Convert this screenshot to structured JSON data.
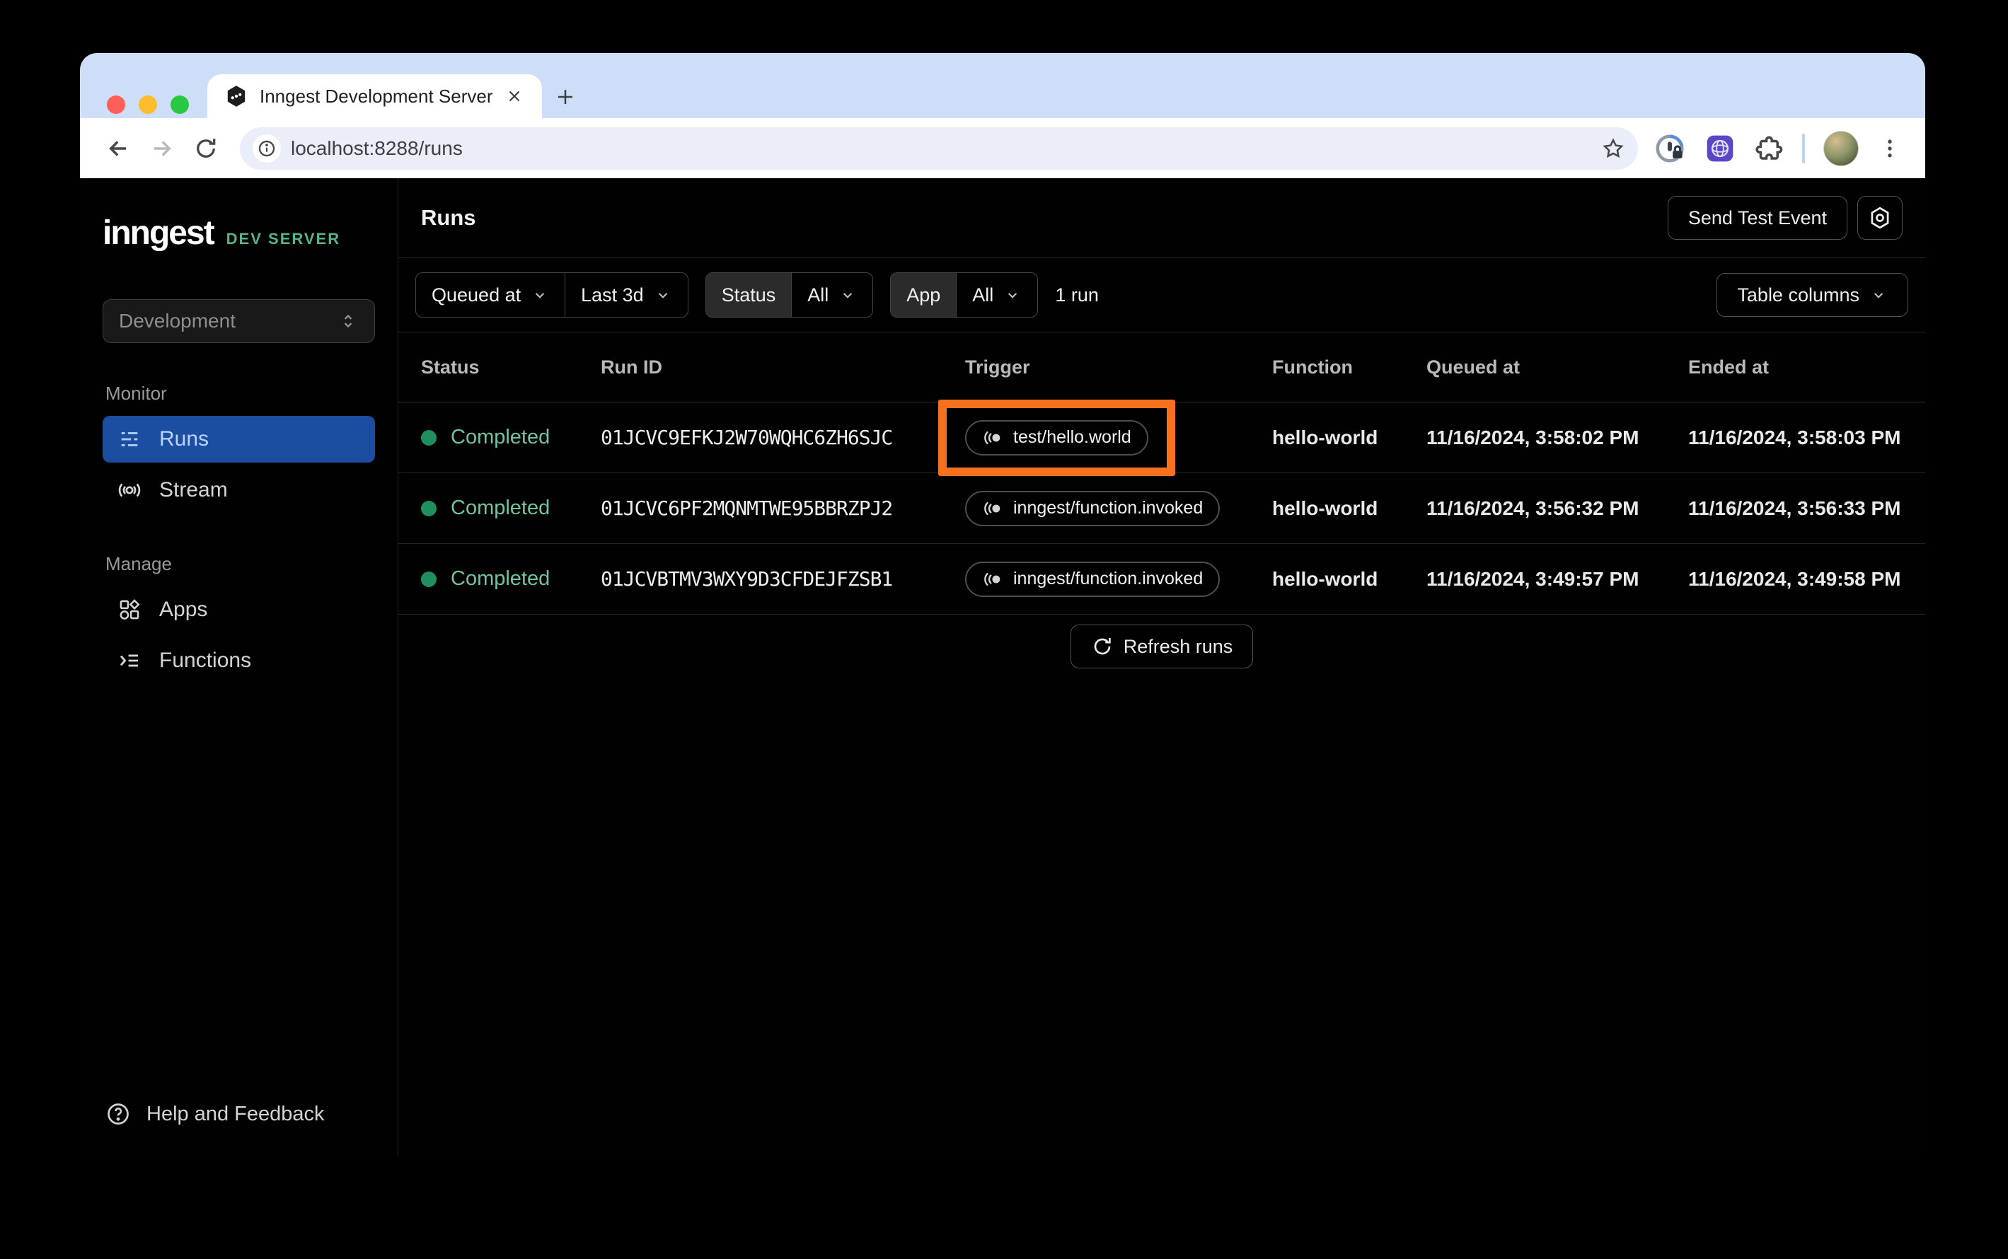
{
  "browser": {
    "tab_title": "Inngest Development Server",
    "url": "localhost:8288/runs"
  },
  "sidebar": {
    "logo": "inngest",
    "logo_badge": "DEV SERVER",
    "env_select": {
      "value": "Development"
    },
    "sections": [
      {
        "label": "Monitor",
        "items": [
          {
            "label": "Runs",
            "active": true
          },
          {
            "label": "Stream",
            "active": false
          }
        ]
      },
      {
        "label": "Manage",
        "items": [
          {
            "label": "Apps",
            "active": false
          },
          {
            "label": "Functions",
            "active": false
          }
        ]
      }
    ],
    "footer": {
      "help_label": "Help and Feedback"
    }
  },
  "header": {
    "title": "Runs",
    "send_test_event_label": "Send Test Event"
  },
  "filters": {
    "queued_at_label": "Queued at",
    "time_range_value": "Last 3d",
    "status_label": "Status",
    "status_value": "All",
    "app_label": "App",
    "app_value": "All",
    "run_count": "1 run",
    "table_columns_label": "Table columns"
  },
  "table": {
    "columns": {
      "status": "Status",
      "run_id": "Run ID",
      "trigger": "Trigger",
      "function": "Function",
      "queued_at": "Queued at",
      "ended_at": "Ended at"
    },
    "rows": [
      {
        "status": "Completed",
        "run_id": "01JCVC9EFKJ2W70WQHC6ZH6SJC",
        "trigger": "test/hello.world",
        "function": "hello-world",
        "queued_at": "11/16/2024, 3:58:02 PM",
        "ended_at": "11/16/2024, 3:58:03 PM",
        "highlighted": true
      },
      {
        "status": "Completed",
        "run_id": "01JCVC6PF2MQNMTWE95BBRZPJ2",
        "trigger": "inngest/function.invoked",
        "function": "hello-world",
        "queued_at": "11/16/2024, 3:56:32 PM",
        "ended_at": "11/16/2024, 3:56:33 PM",
        "highlighted": false
      },
      {
        "status": "Completed",
        "run_id": "01JCVBTMV3WXY9D3CFDEJFZSB1",
        "trigger": "inngest/function.invoked",
        "function": "hello-world",
        "queued_at": "11/16/2024, 3:49:57 PM",
        "ended_at": "11/16/2024, 3:49:58 PM",
        "highlighted": false
      }
    ],
    "refresh_label": "Refresh runs"
  },
  "colors": {
    "highlight_orange": "#f5711d",
    "active_nav_blue": "#1b4da1",
    "success_green": "#1f8f5f",
    "success_text_green": "#74c39d",
    "dev_server_green": "#57b487",
    "tabstrip_blue": "#cfdef8"
  }
}
